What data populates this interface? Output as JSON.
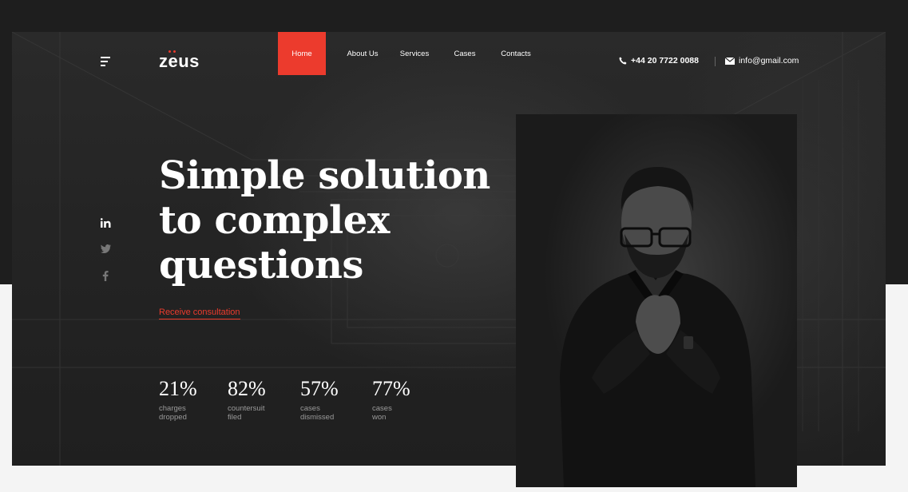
{
  "brand": {
    "logo_text": "zeus"
  },
  "nav": {
    "items": [
      {
        "label": "Home",
        "active": true
      },
      {
        "label": "About Us",
        "active": false
      },
      {
        "label": "Services",
        "active": false
      },
      {
        "label": "Cases",
        "active": false
      },
      {
        "label": "Contacts",
        "active": false
      }
    ]
  },
  "contacts": {
    "phone": "+44 20 7722 0088",
    "email": "info@gmail.com"
  },
  "social": [
    "linkedin-icon",
    "twitter-icon",
    "facebook-icon"
  ],
  "hero": {
    "headline_lines": [
      "Simple solution",
      "to complex",
      "questions"
    ],
    "cta": "Receive consultation"
  },
  "stats": [
    {
      "value": "21%",
      "label_line1": "charges",
      "label_line2": "dropped"
    },
    {
      "value": "82%",
      "label_line1": "countersuit",
      "label_line2": "filed"
    },
    {
      "value": "57%",
      "label_line1": "cases",
      "label_line2": "dismissed"
    },
    {
      "value": "77%",
      "label_line1": "cases",
      "label_line2": "won"
    }
  ],
  "colors": {
    "accent": "#ec3b2d",
    "hero_bg": "#242424",
    "page_bg": "#f4f4f4",
    "text": "#ffffff",
    "muted": "#9a9a9a"
  }
}
